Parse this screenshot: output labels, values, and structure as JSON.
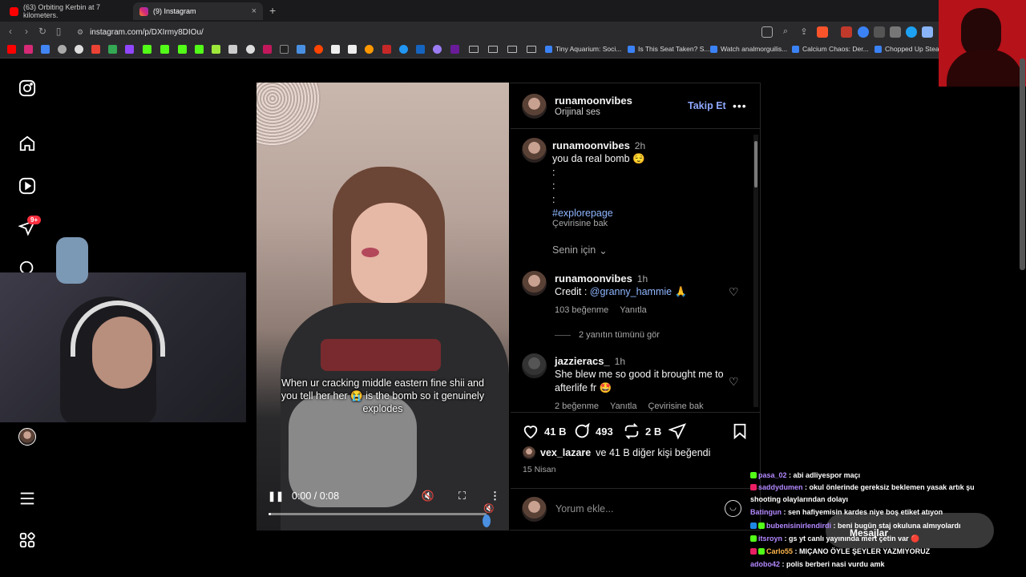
{
  "browser": {
    "tabs": [
      {
        "title": "(63) Orbiting Kerbin at 7 kilometers.",
        "favicon_color": "#ff0000",
        "active": false
      },
      {
        "title": "(9) Instagram",
        "favicon_color": "#d62976",
        "active": true
      }
    ],
    "new_tab_label": "+",
    "close_label": "×",
    "url": "instagram.com/p/DXIrmy8DIOu/",
    "bookmarks": [
      {
        "label": "Tiny Aquarium: Soci..."
      },
      {
        "label": "Is This Seat Taken? S..."
      },
      {
        "label": "Watch analmorguilis..."
      },
      {
        "label": "Calcium Chaos: Der..."
      },
      {
        "label": "Chopped Up Steam"
      }
    ]
  },
  "sidebar": {
    "notification_badge": "9+"
  },
  "video": {
    "caption": "When ur cracking middle eastern fine shii and you tell her her 😭 is the bomb so it genuinely explodes",
    "time": "0:00 / 0:08",
    "progress": 0.0
  },
  "post": {
    "author": "runamoonvibes",
    "audio": "Orijinal ses",
    "follow_label": "Takip Et",
    "more_label": "•••",
    "caption": {
      "user": "runamoonvibes",
      "time": "2h",
      "line1": "you da real bomb 😌",
      "dots": [
        ":",
        ":",
        ":"
      ],
      "hashtag": "#explorepage",
      "translate": "Çevirisine bak"
    },
    "for_you": "Senin için",
    "comments": [
      {
        "user": "runamoonvibes",
        "time": "1h",
        "text_prefix": "Credit : ",
        "mention": "@granny_hammie",
        "text_suffix": " 🙏",
        "likes": "103 beğenme",
        "reply": "Yanıtla",
        "view_replies": "2 yanıtın tümünü gör"
      },
      {
        "user": "jazzieracs_",
        "time": "1h",
        "text": "She blew me so good it brought me to afterlife fr 🤩",
        "likes": "2 beğenme",
        "reply": "Yanıtla",
        "translate": "Çevirisine bak"
      }
    ],
    "like_count": "41 B",
    "comment_count": "493",
    "repost_count": "2 B",
    "liked_by_user": "vex_lazare",
    "liked_by_rest": "ve 41 B diğer kişi beğendi",
    "date": "15 Nisan",
    "comment_placeholder": "Yorum ekle..."
  },
  "messages_label": "Mesajlar",
  "chat": [
    {
      "user": "pasa_02",
      "color": "#b388ff",
      "text": ": abi adliyespor maçı"
    },
    {
      "user": "saddydumen",
      "color": "#b388ff",
      "text": ": okul önlerinde gereksiz beklemen yasak artık şu shooting olaylarından dolayı"
    },
    {
      "user": "Batingun",
      "color": "#b388ff",
      "text": ": sen hafiyemisin kardes niye boş etiket atıyon"
    },
    {
      "user": "bubenisinirlendirdi",
      "color": "#b388ff",
      "text": ": beni bugün staj okuluna almıyolardı"
    },
    {
      "user": "itsroyn",
      "color": "#b388ff",
      "text": ": gs yt canlı yayınında mert çetin var 🔴"
    },
    {
      "user": "Carlo55",
      "color": "#ffb74d",
      "text": ": MIÇANO ÖYLE ŞEYLER YAZMIYORUZ"
    },
    {
      "user": "adobo42",
      "color": "#b388ff",
      "text": ": polis berberi nasi vurdu amk"
    }
  ]
}
